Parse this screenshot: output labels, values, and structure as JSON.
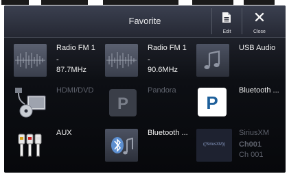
{
  "header": {
    "title": "Favorite",
    "edit_label": "Edit",
    "close_label": "Close"
  },
  "tiles": [
    {
      "name": "Radio FM 1",
      "line2": "-",
      "line3": "87.7MHz",
      "icon": "radio-waveform-icon",
      "enabled": true
    },
    {
      "name": "Radio FM 1",
      "line2": "-",
      "line3": "90.6MHz",
      "icon": "radio-waveform-icon",
      "enabled": true
    },
    {
      "name": "USB Audio",
      "icon": "music-note-icon",
      "enabled": true
    },
    {
      "name": "HDMI/DVD",
      "icon": "hdmi-dvd-icon",
      "enabled": false
    },
    {
      "name": "Pandora",
      "icon": "pandora-icon",
      "enabled": false
    },
    {
      "name": "Bluetooth ...",
      "icon": "pandora-icon",
      "enabled": true
    },
    {
      "name": "AUX",
      "icon": "rca-cable-icon",
      "enabled": true
    },
    {
      "name": "Bluetooth ...",
      "icon": "bluetooth-audio-icon",
      "enabled": true
    },
    {
      "name": "SiriusXM",
      "line2": "Ch001",
      "line3": "Ch 001",
      "icon": "siriusxm-logo",
      "icon_text": "((SiriusXM))",
      "enabled": false
    }
  ],
  "pager": {
    "pages": 2,
    "current": 1
  },
  "colors": {
    "background": "#07080b",
    "header": "#2f3340",
    "text": "#f2f2f2",
    "disabled_text": "#5e626c",
    "pandora_blue": "#1d5f9a"
  }
}
